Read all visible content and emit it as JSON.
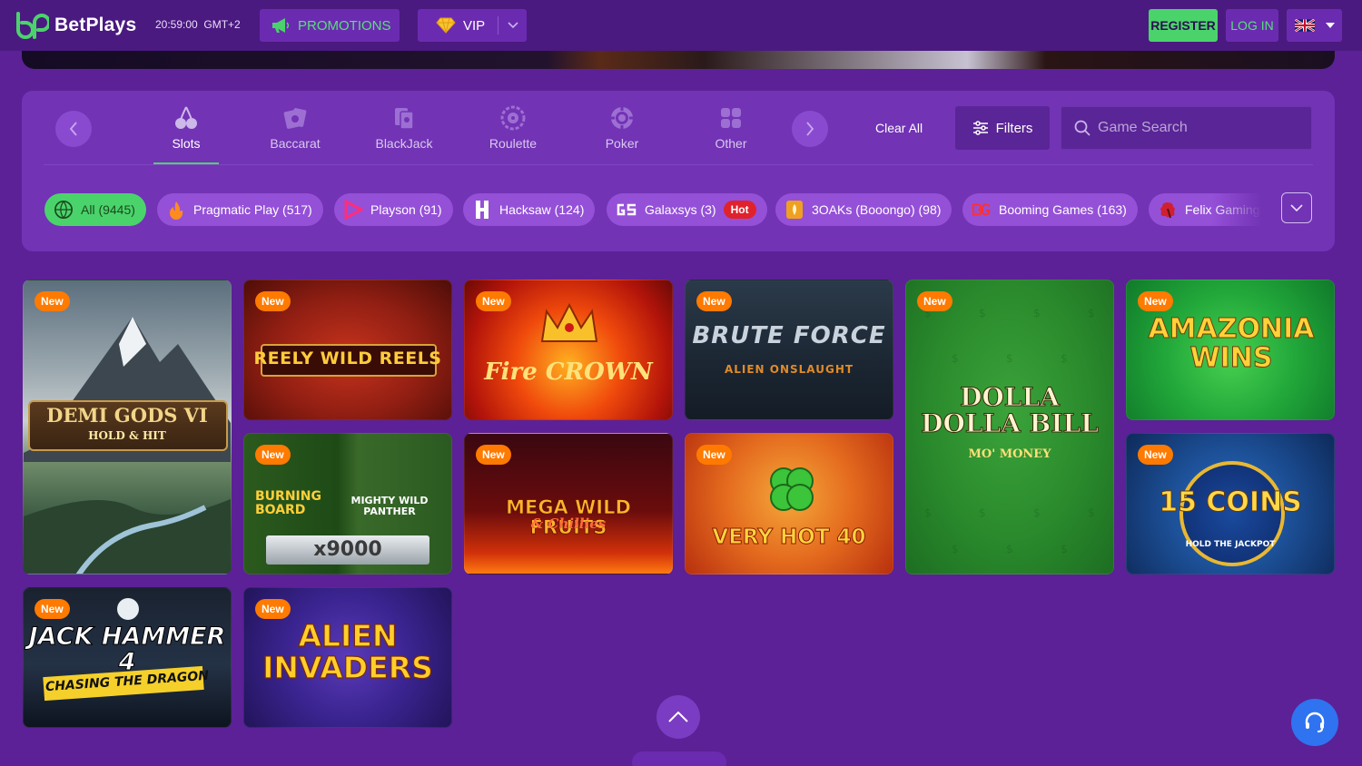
{
  "header": {
    "brand": "BetPlays",
    "clock": "20:59:00",
    "timezone": "GMT+2",
    "promotions_label": "PROMOTIONS",
    "vip_label": "VIP",
    "register_label": "REGISTER",
    "login_label": "LOG IN",
    "language_icon": "uk-flag-icon"
  },
  "categories": [
    {
      "label": "Slots",
      "icon": "cherries-icon",
      "active": true
    },
    {
      "label": "Baccarat",
      "icon": "cards-icon",
      "active": false
    },
    {
      "label": "BlackJack",
      "icon": "blackjack-icon",
      "active": false
    },
    {
      "label": "Roulette",
      "icon": "roulette-icon",
      "active": false
    },
    {
      "label": "Poker",
      "icon": "poker-chip-icon",
      "active": false
    },
    {
      "label": "Other",
      "icon": "grid-icon",
      "active": false
    }
  ],
  "filters": {
    "clear_all_label": "Clear All",
    "filters_label": "Filters",
    "search_placeholder": "Game Search"
  },
  "providers": [
    {
      "label": "All (9445)",
      "active": true
    },
    {
      "label": "Pragmatic Play (517)"
    },
    {
      "label": "Playson (91)"
    },
    {
      "label": "Hacksaw (124)"
    },
    {
      "label": "Galaxsys (3)",
      "badge": "Hot"
    },
    {
      "label": "3OAKs (Booongo) (98)"
    },
    {
      "label": "Booming Games (163)"
    },
    {
      "label": "Felix Gaming"
    }
  ],
  "games": {
    "new_badge": "New",
    "items": [
      {
        "title": "DEMI GODS VI",
        "subtitle": "HOLD & HIT"
      },
      {
        "title": "REELY WILD REELS"
      },
      {
        "title": "Fire CROWN"
      },
      {
        "title": "BRUTE FORCE",
        "subtitle": "ALIEN ONSLAUGHT"
      },
      {
        "title": "DOLLA DOLLA BILL",
        "subtitle": "MO' MONEY"
      },
      {
        "title": "AMAZONIA WINS"
      },
      {
        "title": "BURNING BOARD",
        "subtitle": "MIGHTY WILD PANTHER",
        "extra": "x9000"
      },
      {
        "title": "MEGA WILD FRUITS",
        "subtitle": "& Chillies"
      },
      {
        "title": "VERY HOT 40"
      },
      {
        "title": "15 COINS",
        "subtitle": "HOLD THE JACKPOT"
      },
      {
        "title": "JACK HAMMER 4",
        "subtitle": "CHASING THE DRAGON"
      },
      {
        "title": "ALIEN INVADERS"
      }
    ]
  },
  "colors": {
    "background": "#5c2196",
    "header": "#4a1a80",
    "panel": "#7233b5",
    "accent_green": "#4bd36b",
    "new_badge": "#ff7a00",
    "hot_badge": "#e0222c"
  }
}
